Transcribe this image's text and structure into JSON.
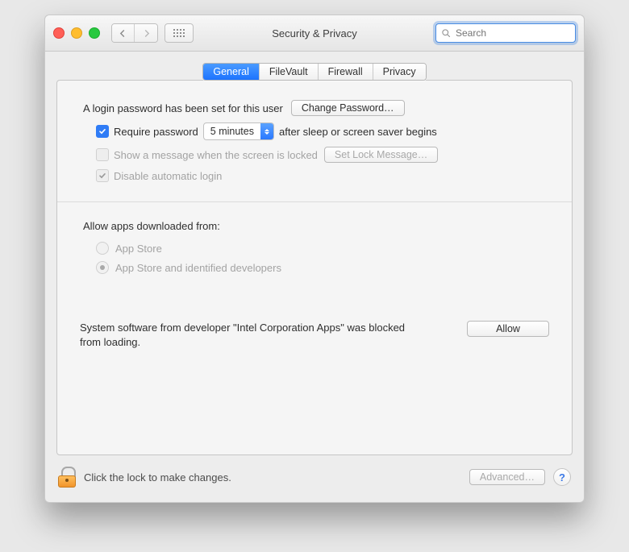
{
  "window": {
    "title": "Security & Privacy"
  },
  "search": {
    "placeholder": "Search",
    "value": ""
  },
  "tabs": [
    "General",
    "FileVault",
    "Firewall",
    "Privacy"
  ],
  "active_tab": "General",
  "login_pw": {
    "message": "A login password has been set for this user",
    "change_btn": "Change Password…"
  },
  "require_pw": {
    "checked": true,
    "label_before": "Require password",
    "delay": "5 minutes",
    "label_after": "after sleep or screen saver begins"
  },
  "show_msg": {
    "checked": false,
    "label": "Show a message when the screen is locked",
    "button": "Set Lock Message…"
  },
  "disable_auto": {
    "checked": true,
    "label": "Disable automatic login"
  },
  "allow_apps": {
    "heading": "Allow apps downloaded from:",
    "options": [
      "App Store",
      "App Store and identified developers"
    ],
    "selected": 1
  },
  "blocked": {
    "text": "System software from developer \"Intel Corporation Apps\" was blocked from loading.",
    "button": "Allow"
  },
  "footer": {
    "lock_text": "Click the lock to make changes.",
    "advanced": "Advanced…"
  },
  "help_glyph": "?"
}
